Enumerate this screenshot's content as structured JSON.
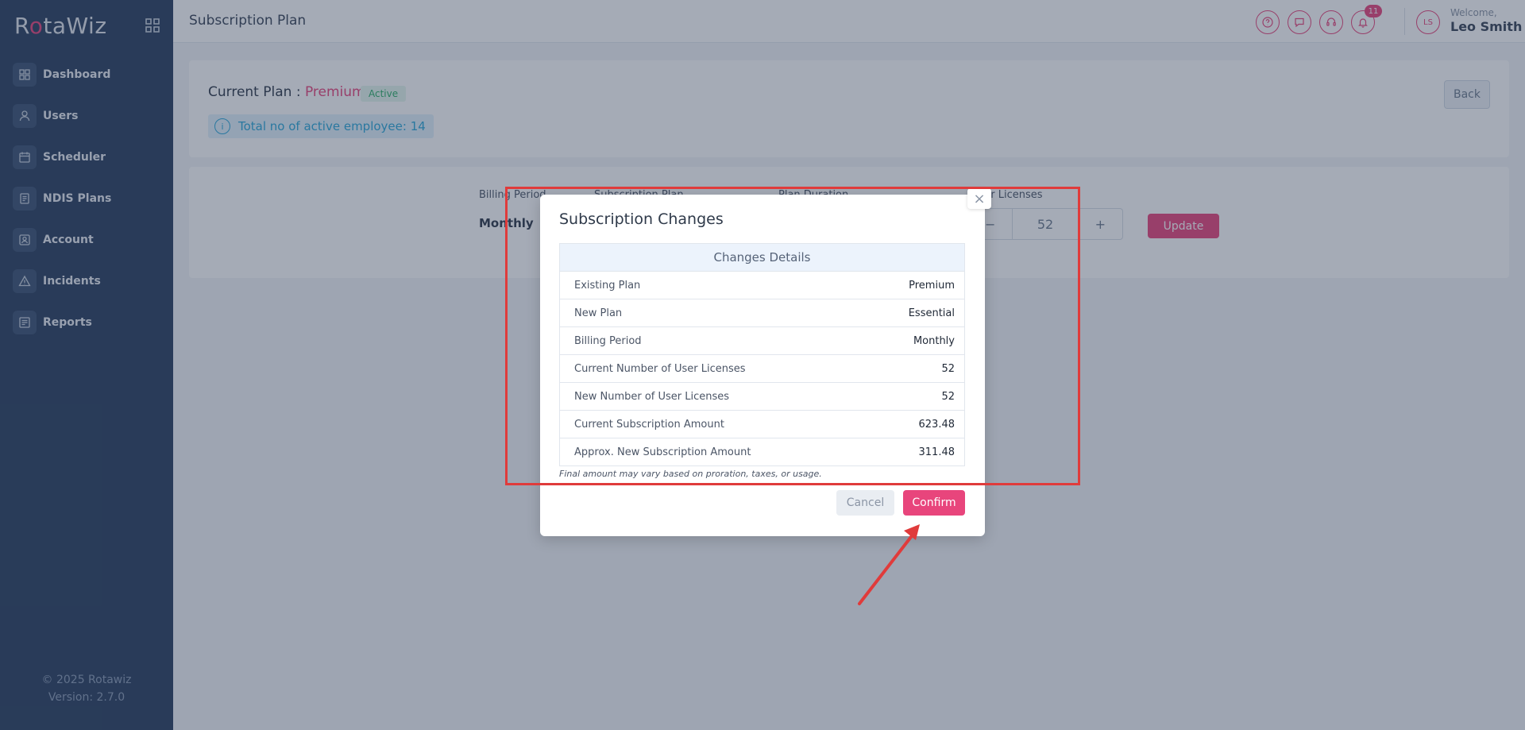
{
  "app": {
    "logo_prefix": "R",
    "logo_accent": "o",
    "logo_suffix": "taWiz"
  },
  "sidebar": {
    "items": [
      {
        "label": "Dashboard",
        "icon": "dashboard-icon"
      },
      {
        "label": "Users",
        "icon": "user-icon"
      },
      {
        "label": "Scheduler",
        "icon": "calendar-icon"
      },
      {
        "label": "NDIS Plans",
        "icon": "document-icon"
      },
      {
        "label": "Account",
        "icon": "account-icon"
      },
      {
        "label": "Incidents",
        "icon": "warning-icon"
      },
      {
        "label": "Reports",
        "icon": "report-icon"
      }
    ],
    "copyright": "© 2025 Rotawiz",
    "version": "Version: 2.7.0"
  },
  "header": {
    "page_title": "Subscription Plan",
    "notification_count": "11",
    "avatar_initials": "LS",
    "welcome_label": "Welcome,",
    "user_name": "Leo Smith"
  },
  "plan_card": {
    "current_plan_label": "Current Plan : ",
    "plan_name": "Premium",
    "status_badge": "Active",
    "employee_info": "Total no of active employee: 14",
    "back_label": "Back"
  },
  "form": {
    "billing_period_label": "Billing Period",
    "subscription_plan_label": "Subscription Plan",
    "plan_duration_label": "Plan Duration",
    "user_licenses_label": "User Licenses",
    "billing_value": "Monthly",
    "minus": "−",
    "quantity": "52",
    "plus": "+",
    "update_label": "Update"
  },
  "modal": {
    "title": "Subscription Changes",
    "close": "×",
    "table_header": "Changes Details",
    "rows": [
      {
        "label": "Existing Plan",
        "value": "Premium"
      },
      {
        "label": "New Plan",
        "value": "Essential"
      },
      {
        "label": "Billing Period",
        "value": "Monthly"
      },
      {
        "label": "Current Number of User Licenses",
        "value": "52"
      },
      {
        "label": "New Number of User Licenses",
        "value": "52"
      },
      {
        "label": "Current Subscription Amount",
        "value": "623.48"
      },
      {
        "label": "Approx. New Subscription Amount",
        "value": "311.48"
      }
    ],
    "note": "Final amount may vary based on proration, taxes, or usage.",
    "cancel_label": "Cancel",
    "confirm_label": "Confirm"
  },
  "colors": {
    "accent": "#e8457c",
    "sidebar_bg": "#2a3f5f",
    "annotation_red": "#e03b3b"
  }
}
